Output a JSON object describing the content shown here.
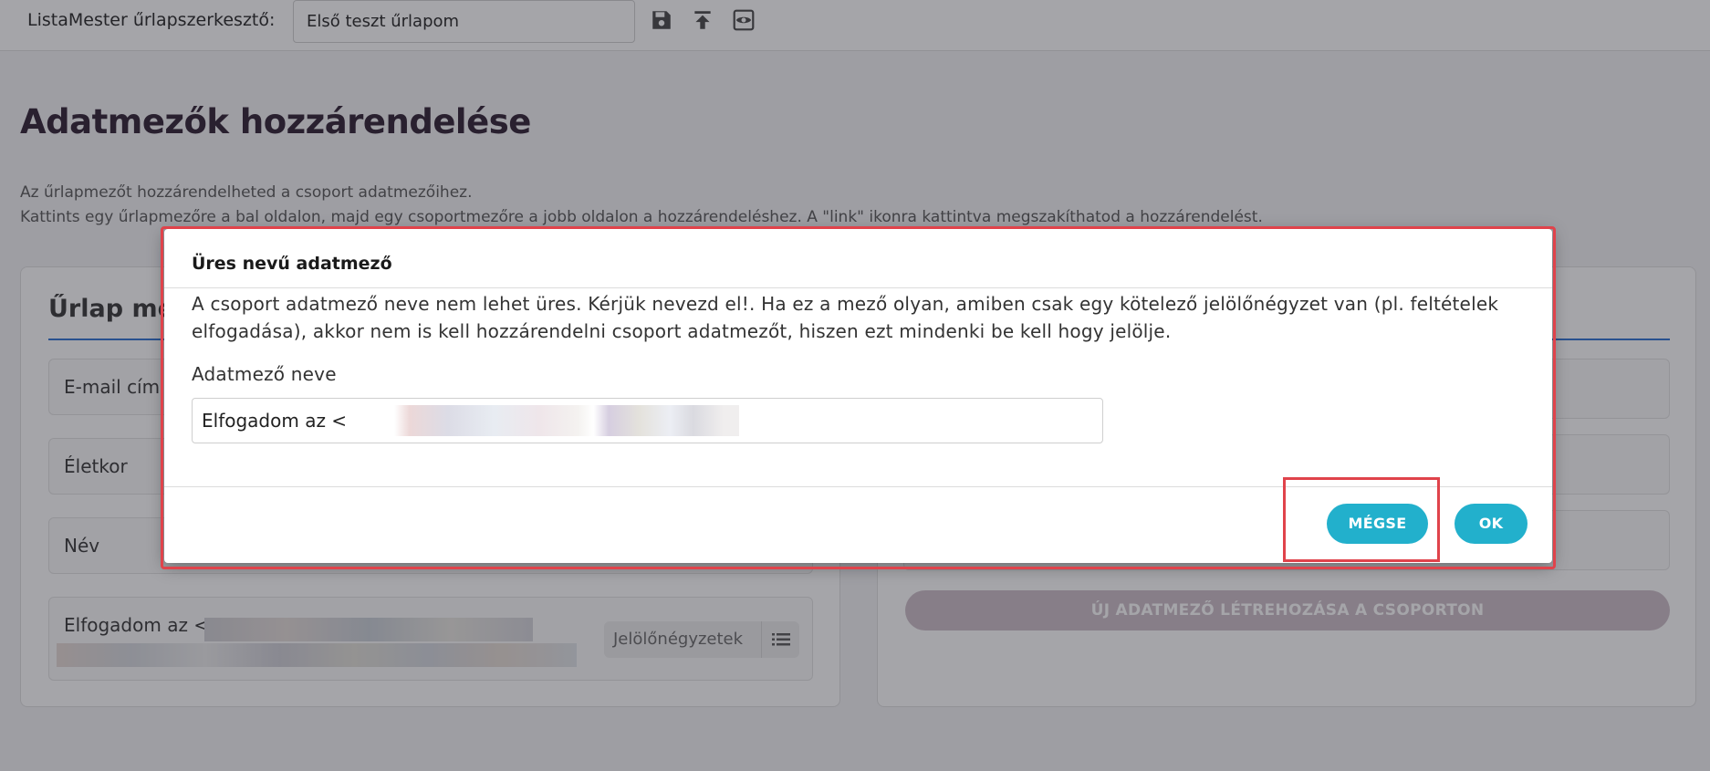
{
  "topbar": {
    "app_title": "ListaMester űrlapszerkesztő:",
    "form_title_value": "Első teszt űrlapom",
    "icons": [
      "save-icon",
      "upload-icon",
      "preview-eye-icon"
    ]
  },
  "page": {
    "title": "Adatmezők hozzárendelése",
    "desc_line1": "Az űrlapmezőt hozzárendelheted a csoport adatmezőihez.",
    "desc_line2": "Kattints egy űrlapmezőre a bal oldalon, majd egy csoportmezőre a jobb oldalon a hozzárendeléshez. A \"link\" ikonra kattintva megszakíthatod a hozzárendelést."
  },
  "left_panel": {
    "heading": "Űrlap mezők",
    "fields": [
      {
        "label": "E-mail cím"
      },
      {
        "label": "Életkor"
      },
      {
        "label": "Név"
      },
      {
        "label": "Elfogadom az <",
        "type": "Jelölőnégyzetek"
      }
    ]
  },
  "right_panel": {
    "new_field_button": "ÚJ ADATMEZŐ LÉTREHOZÁSA A CSOPORTON"
  },
  "modal": {
    "title": "Üres nevű adatmező",
    "body": "A csoport adatmező neve nem lehet üres. Kérjük nevezd el!. Ha ez a mező olyan, amiben csak egy kötelező jelölőnégyzet van (pl. feltételek elfogadása), akkor nem is kell hozzárendelni csoport adatmezőt, hiszen ezt mindenki be kell hogy jelölje.",
    "field_label": "Adatmező neve",
    "field_value": "Elfogadom az <",
    "cancel_label": "MÉGSE",
    "ok_label": "OK"
  },
  "colors": {
    "accent_button": "#22b0cc",
    "highlight_frame": "#e0434b",
    "panel_underline": "#2a6fd0",
    "disabled_button": "#cbbcc6"
  }
}
